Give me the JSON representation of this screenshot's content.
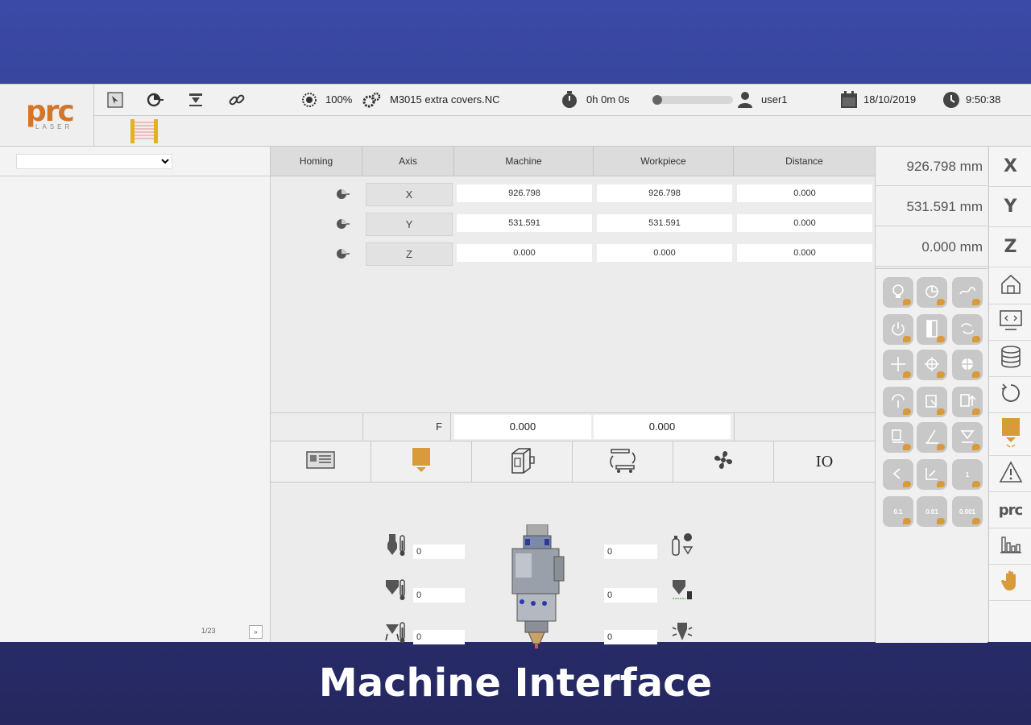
{
  "brand": {
    "logo_text": "prc",
    "logo_sub": "LASER"
  },
  "topbar": {
    "speed": "100%",
    "program": "M3015 extra covers.NC",
    "timer": "0h 0m 0s",
    "progress": 0.0,
    "user": "user1",
    "date": "18/10/2019",
    "time": "9:50:38"
  },
  "left": {
    "page": "1/23",
    "page_button": "»"
  },
  "table": {
    "headers": [
      "Homing",
      "Axis",
      "Machine",
      "Workpiece",
      "Distance"
    ],
    "rows": [
      {
        "axis": "X",
        "machine": "926.798",
        "workpiece": "926.798",
        "distance": "0.000"
      },
      {
        "axis": "Y",
        "machine": "531.591",
        "workpiece": "531.591",
        "distance": "0.000"
      },
      {
        "axis": "Z",
        "machine": "0.000",
        "workpiece": "0.000",
        "distance": "0.000"
      }
    ],
    "feed_label": "F",
    "feed_machine": "0.000",
    "feed_workpiece": "0.000"
  },
  "tabs": {
    "io_label": "IO"
  },
  "head_panel": {
    "left_values": [
      "0",
      "0",
      "0"
    ],
    "right_values": [
      "0",
      "0",
      "0"
    ]
  },
  "coords": {
    "x": "926.798 mm",
    "y": "531.591 mm",
    "z": "0.000 mm"
  },
  "jog_steps": [
    "0.1",
    "0.01",
    "0.001"
  ],
  "step_one": "1",
  "sidebar": {
    "x": "X",
    "y": "Y",
    "z": "Z",
    "logo": "prc"
  },
  "caption": "Machine Interface",
  "colors": {
    "accent": "#d99a3a",
    "brand": "#d4762a",
    "frame": "#3b4aa6"
  }
}
